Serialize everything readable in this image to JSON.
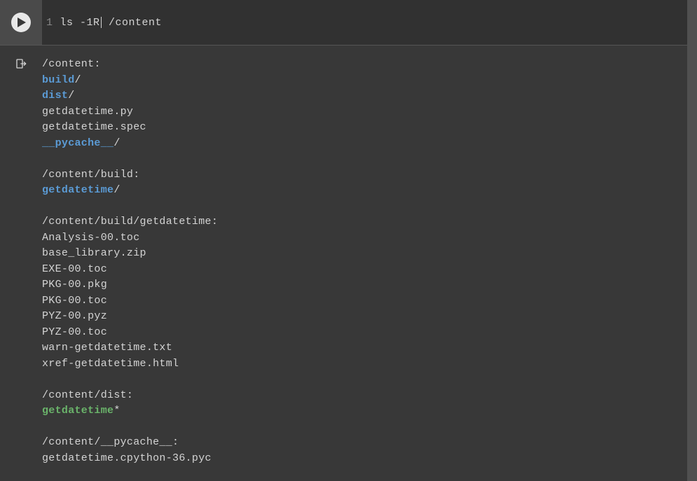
{
  "cell": {
    "line_number": "1",
    "code_before_cursor": "ls -1R",
    "code_after_cursor": " /content"
  },
  "output": {
    "lines": [
      {
        "segments": [
          {
            "text": "/content:",
            "cls": "plain"
          }
        ]
      },
      {
        "segments": [
          {
            "text": "build",
            "cls": "dir-link"
          },
          {
            "text": "/",
            "cls": "plain"
          }
        ]
      },
      {
        "segments": [
          {
            "text": "dist",
            "cls": "dir-link"
          },
          {
            "text": "/",
            "cls": "plain"
          }
        ]
      },
      {
        "segments": [
          {
            "text": "getdatetime.py",
            "cls": "plain"
          }
        ]
      },
      {
        "segments": [
          {
            "text": "getdatetime.spec",
            "cls": "plain"
          }
        ]
      },
      {
        "segments": [
          {
            "text": "__pycache__",
            "cls": "dir-link"
          },
          {
            "text": "/",
            "cls": "plain"
          }
        ]
      },
      {
        "segments": []
      },
      {
        "segments": [
          {
            "text": "/content/build:",
            "cls": "plain"
          }
        ]
      },
      {
        "segments": [
          {
            "text": "getdatetime",
            "cls": "dir-link"
          },
          {
            "text": "/",
            "cls": "plain"
          }
        ]
      },
      {
        "segments": []
      },
      {
        "segments": [
          {
            "text": "/content/build/getdatetime:",
            "cls": "plain"
          }
        ]
      },
      {
        "segments": [
          {
            "text": "Analysis-00.toc",
            "cls": "plain"
          }
        ]
      },
      {
        "segments": [
          {
            "text": "base_library.zip",
            "cls": "plain"
          }
        ]
      },
      {
        "segments": [
          {
            "text": "EXE-00.toc",
            "cls": "plain"
          }
        ]
      },
      {
        "segments": [
          {
            "text": "PKG-00.pkg",
            "cls": "plain"
          }
        ]
      },
      {
        "segments": [
          {
            "text": "PKG-00.toc",
            "cls": "plain"
          }
        ]
      },
      {
        "segments": [
          {
            "text": "PYZ-00.pyz",
            "cls": "plain"
          }
        ]
      },
      {
        "segments": [
          {
            "text": "PYZ-00.toc",
            "cls": "plain"
          }
        ]
      },
      {
        "segments": [
          {
            "text": "warn-getdatetime.txt",
            "cls": "plain"
          }
        ]
      },
      {
        "segments": [
          {
            "text": "xref-getdatetime.html",
            "cls": "plain"
          }
        ]
      },
      {
        "segments": []
      },
      {
        "segments": [
          {
            "text": "/content/dist:",
            "cls": "plain"
          }
        ]
      },
      {
        "segments": [
          {
            "text": "getdatetime",
            "cls": "exec-link"
          },
          {
            "text": "*",
            "cls": "plain"
          }
        ]
      },
      {
        "segments": []
      },
      {
        "segments": [
          {
            "text": "/content/__pycache__:",
            "cls": "plain"
          }
        ]
      },
      {
        "segments": [
          {
            "text": "getdatetime.cpython-36.pyc",
            "cls": "plain"
          }
        ]
      }
    ]
  }
}
